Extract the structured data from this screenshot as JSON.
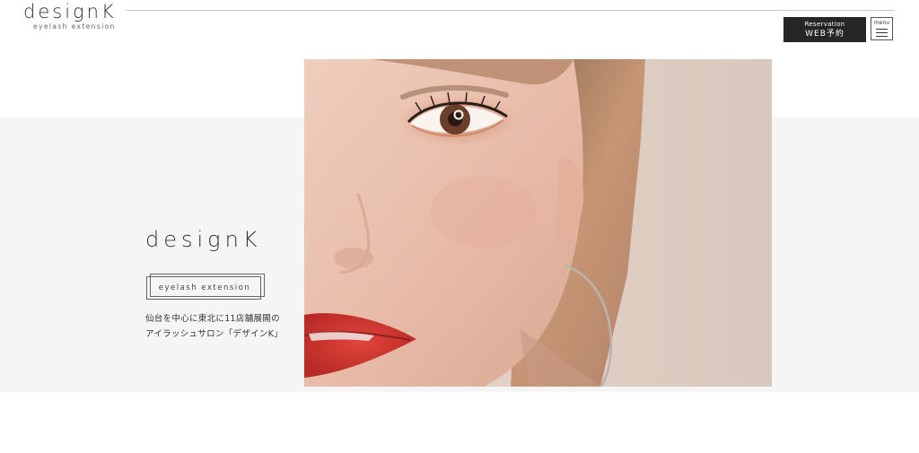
{
  "header": {
    "logo_main": "designK",
    "logo_sub": "eyelash extension",
    "reserve_en": "Reservation",
    "reserve_ja": "WEB予約",
    "menu_label": "menu"
  },
  "hero": {
    "brand": "designK",
    "tag": "eyelash extension",
    "desc_line1": "仙台を中心に東北に11店舗展開の",
    "desc_line2": "アイラッシュサロン「デザインK」"
  },
  "colors": {
    "accent_dark": "#262626",
    "band_gray": "#f5f5f5",
    "lip_red": "#d93a32"
  },
  "icons": [
    "hamburger-icon"
  ]
}
